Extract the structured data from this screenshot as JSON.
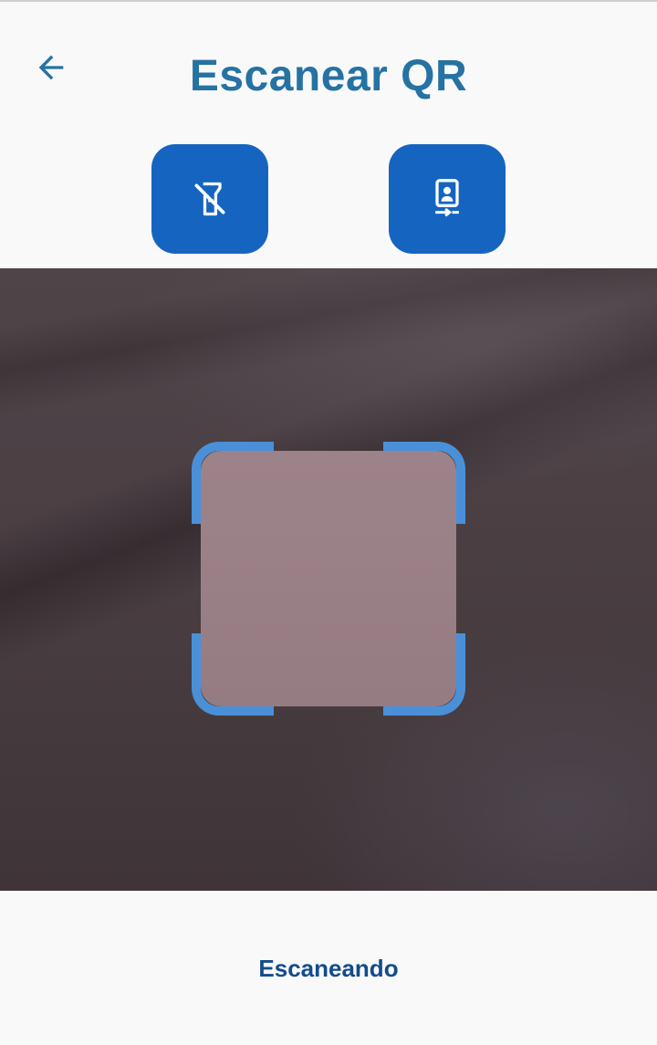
{
  "header": {
    "title": "Escanear QR",
    "back_icon": "arrow-left-icon"
  },
  "toolbar": {
    "flash_icon": "flashlight-off-icon",
    "switch_camera_icon": "switch-camera-icon",
    "button_color": "#1565c0"
  },
  "scanner": {
    "frame_color": "#4a90d9"
  },
  "status": {
    "text": "Escaneando"
  },
  "colors": {
    "title": "#2672a3",
    "status": "#134b8c",
    "background": "#f9f9f9"
  }
}
